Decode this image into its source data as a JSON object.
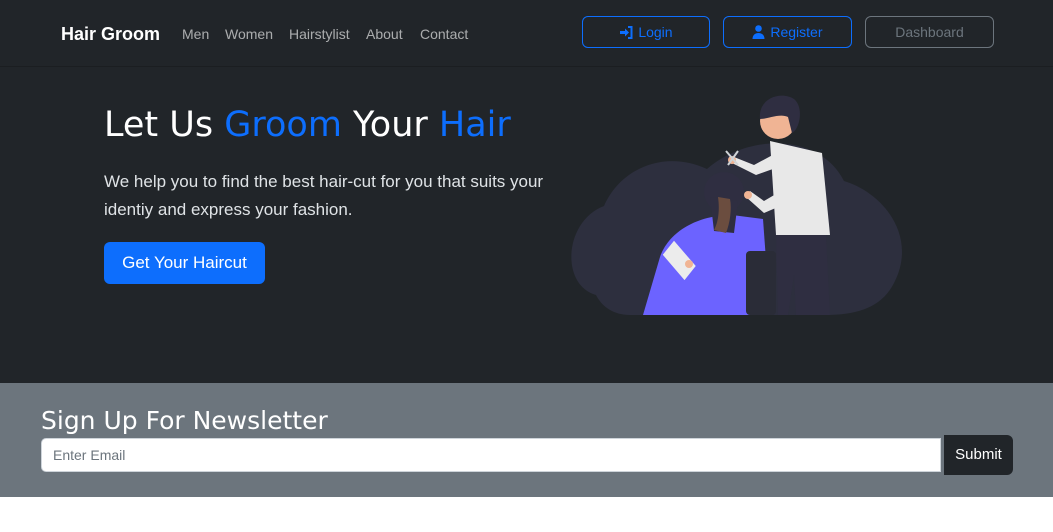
{
  "navbar": {
    "brand": "Hair Groom",
    "links": [
      "Men",
      "Women",
      "Hairstylist",
      "About",
      "Contact"
    ],
    "login_label": "Login",
    "register_label": "Register",
    "dashboard_label": "Dashboard"
  },
  "hero": {
    "title_part1": "Let Us ",
    "title_accent1": "Groom",
    "title_part2": " Your ",
    "title_accent2": "Hair",
    "subtitle": "We help you to find the best hair-cut for you that suits your identiy and express your fashion.",
    "cta_label": "Get Your Haircut"
  },
  "newsletter": {
    "title": "Sign Up For Newsletter",
    "email_placeholder": "Enter Email",
    "submit_label": "Submit"
  },
  "colors": {
    "dark": "#212529",
    "primary": "#0d6efd",
    "muted": "#6c757d"
  },
  "icons": {
    "login": "sign-in-icon",
    "register": "user-icon"
  }
}
